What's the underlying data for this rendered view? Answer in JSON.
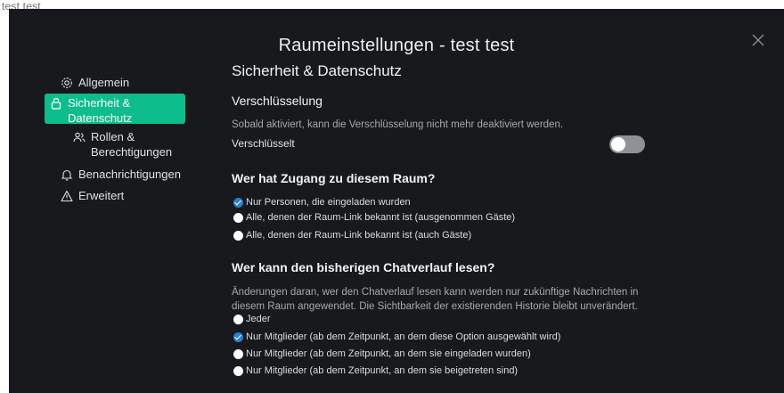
{
  "window": {
    "background_title": "test test"
  },
  "dialog": {
    "title": "Raumeinstellungen - test test",
    "close_icon": "close-x-icon"
  },
  "sidebar": {
    "items": [
      {
        "label": "Allgemein",
        "icon": "settings-icon",
        "active": false
      },
      {
        "label": "Sicherheit & Datenschutz",
        "icon": "lock-icon",
        "active": true
      },
      {
        "label": "Rollen & Berechtigungen",
        "icon": "people-icon",
        "active": false
      },
      {
        "label": "Benachrichtigungen",
        "icon": "bell-icon",
        "active": false
      },
      {
        "label": "Erweitert",
        "icon": "warning-icon",
        "active": false
      }
    ]
  },
  "content": {
    "heading": "Sicherheit & Datenschutz",
    "encryption": {
      "heading": "Verschlüsselung",
      "description": "Sobald aktiviert, kann die Verschlüsselung nicht mehr deaktiviert werden.",
      "toggle_label": "Verschlüsselt",
      "toggle_on": false
    },
    "access": {
      "heading": "Wer hat Zugang zu diesem Raum?",
      "options": [
        {
          "label": "Nur Personen, die eingeladen wurden",
          "checked": true
        },
        {
          "label": "Alle, denen der Raum-Link bekannt ist (ausgenommen Gäste)",
          "checked": false
        },
        {
          "label": "Alle, denen der Raum-Link bekannt ist (auch Gäste)",
          "checked": false
        }
      ]
    },
    "history": {
      "heading": "Wer kann den bisherigen Chatverlauf lesen?",
      "description_line1": "Änderungen daran, wer den Chatverlauf lesen kann werden nur zukünftige Nachrichten in",
      "description_line2": "diesem Raum angewendet. Die Sichtbarkeit der existierenden Historie bleibt unverändert.",
      "options": [
        {
          "label": "Jeder",
          "checked": false
        },
        {
          "label": "Nur Mitglieder (ab dem Zeitpunkt, an dem diese Option ausgewählt wird)",
          "checked": true
        },
        {
          "label": "Nur Mitglieder (ab dem Zeitpunkt, an dem sie eingeladen wurden)",
          "checked": false
        },
        {
          "label": "Nur Mitglieder (ab dem Zeitpunkt, an dem sie beigetreten sind)",
          "checked": false
        }
      ]
    }
  },
  "colors": {
    "accent": "#0dbd8b",
    "background": "#17191c",
    "radio_checked": "#2a7fd4",
    "toggle_off": "#8e9296"
  }
}
